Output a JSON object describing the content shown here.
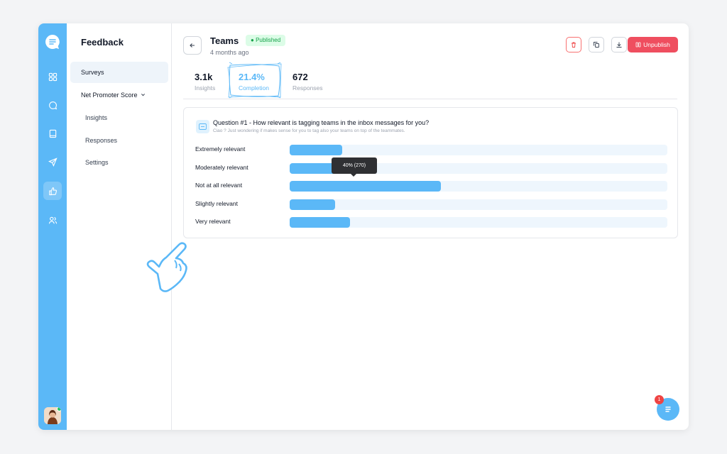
{
  "sidebar": {
    "title": "Feedback",
    "items": [
      {
        "label": "Surveys"
      },
      {
        "label": "Net Promoter Score"
      },
      {
        "label": "Insights"
      },
      {
        "label": "Responses"
      },
      {
        "label": "Settings"
      }
    ]
  },
  "header": {
    "title": "Teams",
    "badge": "Published",
    "subtitle": "4 months ago",
    "unpublish_label": "Unpublish"
  },
  "stats": [
    {
      "value": "3.1k",
      "label": "Insights"
    },
    {
      "value": "21.4%",
      "label": "Completion"
    },
    {
      "value": "672",
      "label": "Responses"
    }
  ],
  "question": {
    "title": "Question #1 - How relevant is tagging teams in the inbox messages for you?",
    "subtitle": "Ciao ? Just wondering if makes sense for you to tag also your teams on top of the teammates.",
    "tooltip": "40% (270)"
  },
  "chart_data": {
    "type": "bar",
    "categories": [
      "Extremely relevant",
      "Moderately relevant",
      "Not at all relevant",
      "Slightly relevant",
      "Very relevant"
    ],
    "values": [
      14,
      13,
      40,
      12,
      16
    ],
    "xlim": [
      0,
      100
    ]
  },
  "chat": {
    "unread": "1"
  },
  "colors": {
    "accent": "#5bb8f7",
    "danger": "#ef4e5f",
    "success": "#16a34a"
  }
}
